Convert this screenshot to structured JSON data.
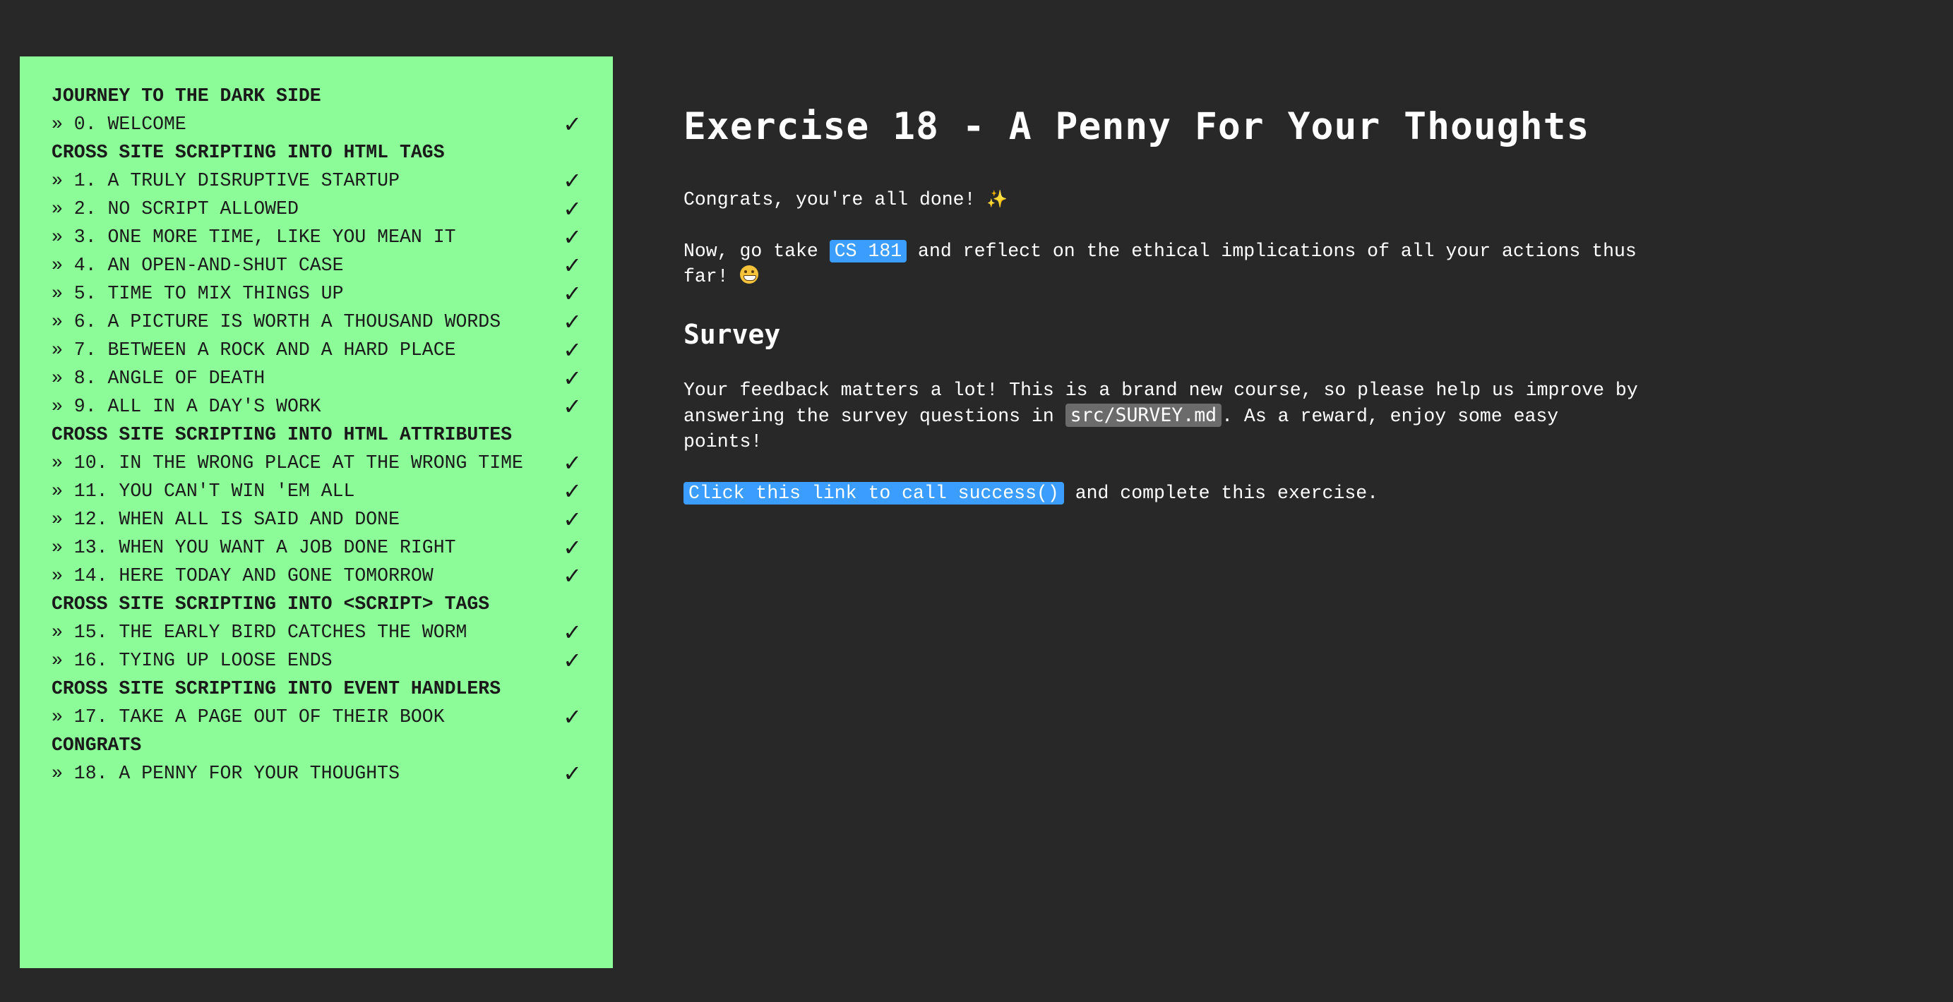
{
  "sidebar": {
    "sections": [
      {
        "title": "JOURNEY TO THE DARK SIDE",
        "items": [
          {
            "label": "» 0. WELCOME",
            "check": "✓"
          }
        ]
      },
      {
        "title": "CROSS SITE SCRIPTING INTO HTML TAGS",
        "items": [
          {
            "label": "» 1. A TRULY DISRUPTIVE STARTUP",
            "check": "✓"
          },
          {
            "label": "» 2. NO SCRIPT ALLOWED",
            "check": "✓"
          },
          {
            "label": "» 3. ONE MORE TIME, LIKE YOU MEAN IT",
            "check": "✓"
          },
          {
            "label": "» 4. AN OPEN-AND-SHUT CASE",
            "check": "✓"
          },
          {
            "label": "» 5. TIME TO MIX THINGS UP",
            "check": "✓"
          },
          {
            "label": "» 6. A PICTURE IS WORTH A THOUSAND WORDS",
            "check": "✓"
          },
          {
            "label": "» 7. BETWEEN A ROCK AND A HARD PLACE",
            "check": "✓"
          },
          {
            "label": "» 8. ANGLE OF DEATH",
            "check": "✓"
          },
          {
            "label": "» 9. ALL IN A DAY'S WORK",
            "check": "✓"
          }
        ]
      },
      {
        "title": "CROSS SITE SCRIPTING INTO HTML ATTRIBUTES",
        "items": [
          {
            "label": "» 10. IN THE WRONG PLACE AT THE WRONG TIME",
            "check": "✓"
          },
          {
            "label": "» 11. YOU CAN'T WIN 'EM ALL",
            "check": "✓"
          },
          {
            "label": "» 12. WHEN ALL IS SAID AND DONE",
            "check": "✓"
          },
          {
            "label": "» 13. WHEN YOU WANT A JOB DONE RIGHT",
            "check": "✓"
          },
          {
            "label": "» 14. HERE TODAY AND GONE TOMORROW",
            "check": "✓"
          }
        ]
      },
      {
        "title": "CROSS SITE SCRIPTING INTO <SCRIPT> TAGS",
        "items": [
          {
            "label": "» 15. THE EARLY BIRD CATCHES THE WORM",
            "check": "✓"
          },
          {
            "label": "» 16. TYING UP LOOSE ENDS",
            "check": "✓"
          }
        ]
      },
      {
        "title": "CROSS SITE SCRIPTING INTO EVENT HANDLERS",
        "items": [
          {
            "label": "» 17. TAKE A PAGE OUT OF THEIR BOOK",
            "check": "✓"
          }
        ]
      },
      {
        "title": "CONGRATS",
        "items": [
          {
            "label": "» 18. A PENNY FOR YOUR THOUGHTS",
            "check": "✓"
          }
        ]
      }
    ]
  },
  "main": {
    "title": "Exercise 18 - A Penny For Your Thoughts",
    "congrats": {
      "text": "Congrats, you're all done! ",
      "emoji": "✨"
    },
    "reflect": {
      "prefix": "Now, go take ",
      "course_link": "CS 181",
      "suffix": " and reflect on the ethical implications of all your actions thus far! ",
      "emoji": "grinning-face"
    },
    "survey": {
      "heading": "Survey",
      "text_before": "Your feedback matters a lot! This is a brand new course, so please help us improve by answering the survey questions in ",
      "file": "src/SURVEY.md",
      "text_after": ". As a reward, enjoy some easy points!"
    },
    "success": {
      "link": "Click this link to call success()",
      "suffix": " and complete this exercise."
    }
  },
  "colors": {
    "background": "#282828",
    "sidebar": "#8cfc98",
    "link": "#3b9dfd",
    "code": "#6b6b6b"
  }
}
